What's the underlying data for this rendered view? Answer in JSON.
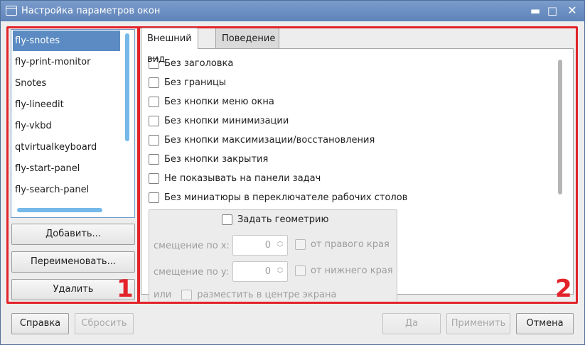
{
  "window": {
    "title": "Настройка параметров окон"
  },
  "titlebar_buttons": {
    "minimize": "▬",
    "maximize": "□",
    "close": "✕"
  },
  "annotations": {
    "badge1": "1",
    "badge2": "2"
  },
  "app_list": {
    "items": [
      "fly-snotes",
      "fly-print-monitor",
      "Snotes",
      "fly-lineedit",
      "fly-vkbd",
      "qtvirtualkeyboard",
      "fly-start-panel",
      "fly-search-panel"
    ],
    "selected": "fly-snotes"
  },
  "left_buttons": {
    "add": "Добавить...",
    "rename": "Переименовать...",
    "delete": "Удалить"
  },
  "tabs": {
    "appearance": "Внешний вид",
    "behavior": "Поведение"
  },
  "options": [
    "Без заголовка",
    "Без границы",
    "Без кнопки меню окна",
    "Без кнопки минимизации",
    "Без кнопки максимизации/восстановления",
    "Без кнопки закрытия",
    "Не показывать на панели задач",
    "Без миниатюры в переключателе рабочих столов"
  ],
  "geometry": {
    "title": "Задать геометрию",
    "x_label": "смещение по x:",
    "x_value": "0",
    "x_right_edge": "от правого края",
    "y_label": "смещение по y:",
    "y_value": "0",
    "y_bottom_edge": "от нижнего края",
    "center_prefix": "или",
    "center_label": "разместить в центре экрана"
  },
  "footer": {
    "help": "Справка",
    "reset": "Сбросить",
    "yes": "Да",
    "apply": "Применить",
    "cancel": "Отмена"
  },
  "colors": {
    "accent": "#5b8bc2",
    "annotation_red": "#e3232a"
  }
}
